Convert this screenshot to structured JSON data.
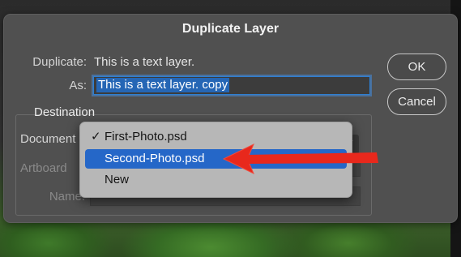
{
  "dialog": {
    "title": "Duplicate Layer",
    "duplicate_label": "Duplicate:",
    "duplicate_value": "This is a text layer.",
    "as_label": "As:",
    "as_value": "This is a text layer. copy",
    "ok_label": "OK",
    "cancel_label": "Cancel",
    "destination": {
      "title": "Destination",
      "document_label": "Document",
      "artboard_label": "Artboard",
      "name_label": "Name:"
    }
  },
  "document_menu": {
    "items": [
      {
        "label": "First-Photo.psd",
        "checked": true
      },
      {
        "label": "Second-Photo.psd",
        "highlighted": true
      },
      {
        "label": "New"
      }
    ],
    "checkmark": "✓"
  },
  "annotation": {
    "arrow_color": "#e8281c",
    "arrow_icon": "red-arrow-pointing-left"
  },
  "colors": {
    "dialog_bg": "#505050",
    "highlight": "#2567c8",
    "menu_bg": "#b7b7b7"
  }
}
